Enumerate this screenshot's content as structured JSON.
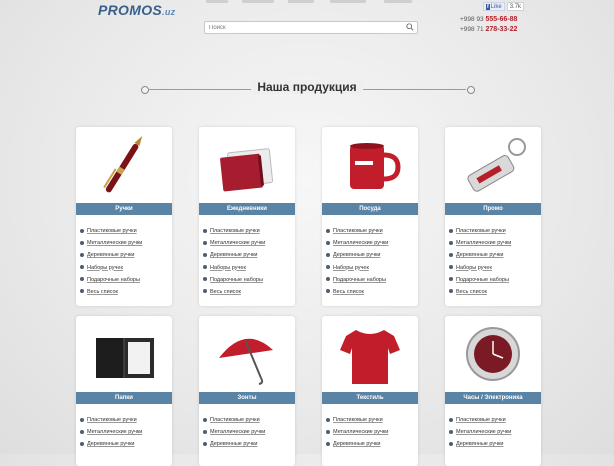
{
  "header": {
    "logo_main": "PROMOS",
    "logo_suffix": ".uz",
    "search_placeholder": "Поиск",
    "fb_like": "Like",
    "fb_count": "3.7k",
    "phones": [
      {
        "prefix": "+998 93",
        "number": "555-66-88"
      },
      {
        "prefix": "+998 71",
        "number": "278-33-22"
      }
    ]
  },
  "section_title": "Наша продукция",
  "categories": [
    {
      "title": "Ручки",
      "icon": "pen-icon",
      "items": [
        "Пластиковые ручки",
        "Металлические ручки",
        "Деревянные ручки",
        "Наборы ручек",
        "Подарочные наборы",
        "Весь список"
      ]
    },
    {
      "title": "Ежедневники",
      "icon": "notebook-icon",
      "items": [
        "Пластиковые ручки",
        "Металлические ручки",
        "Деревянные ручки",
        "Наборы ручек",
        "Подарочные наборы",
        "Весь список"
      ]
    },
    {
      "title": "Посуда",
      "icon": "mug-icon",
      "items": [
        "Пластиковые ручки",
        "Металлические ручки",
        "Деревянные ручки",
        "Наборы ручек",
        "Подарочные наборы",
        "Весь список"
      ]
    },
    {
      "title": "Промо",
      "icon": "keychain-icon",
      "items": [
        "Пластиковые ручки",
        "Металлические ручки",
        "Деревянные ручки",
        "Наборы ручек",
        "Подарочные наборы",
        "Весь список"
      ]
    },
    {
      "title": "Папки",
      "icon": "folder-icon",
      "items": [
        "Пластиковые ручки",
        "Металлические ручки",
        "Деревянные ручки"
      ]
    },
    {
      "title": "Зонты",
      "icon": "umbrella-icon",
      "items": [
        "Пластиковые ручки",
        "Металлические ручки",
        "Деревянные ручки"
      ]
    },
    {
      "title": "Текстиль",
      "icon": "tshirt-icon",
      "items": [
        "Пластиковые ручки",
        "Металлические ручки",
        "Деревянные ручки"
      ]
    },
    {
      "title": "Часы / Электроника",
      "icon": "clock-icon",
      "items": [
        "Пластиковые ручки",
        "Металлические ручки",
        "Деревянные ручки"
      ]
    }
  ],
  "colors": {
    "accent_bar": "#5a84a6",
    "product_red": "#b3202a",
    "phone_red": "#b3202a"
  }
}
